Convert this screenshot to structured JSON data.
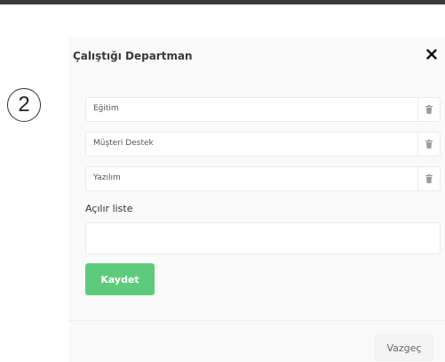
{
  "annotation": {
    "step_number": "2"
  },
  "modal": {
    "title": "Çalıştığı Departman",
    "items": [
      {
        "label": "Eğitim"
      },
      {
        "label": "Müşteri Destek"
      },
      {
        "label": "Yazılım"
      }
    ],
    "dropdown_label": "Açılır liste",
    "dropdown_value": "",
    "save_label": "Kaydet",
    "cancel_label": "Vazgeç"
  },
  "colors": {
    "save_button": "#5ecb7c",
    "top_bar": "#3b3b3b"
  },
  "icons": {
    "close": "close-icon",
    "delete": "trash-icon"
  }
}
